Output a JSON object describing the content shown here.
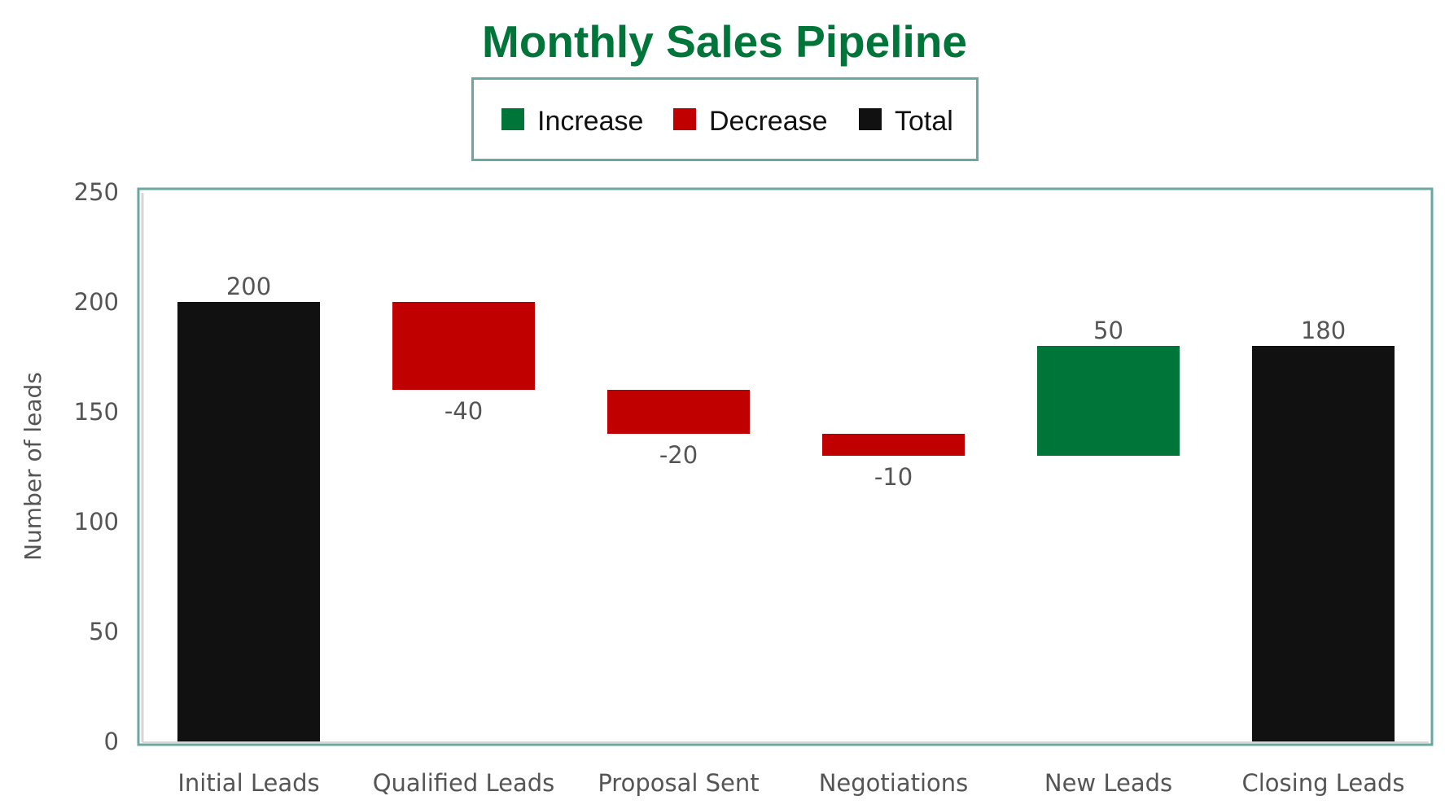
{
  "chart_data": {
    "type": "waterfall",
    "title": "Monthly Sales Pipeline",
    "xlabel": "",
    "ylabel": "Number of leads",
    "ylim": [
      0,
      250
    ],
    "yticks": [
      0,
      50,
      100,
      150,
      200,
      250
    ],
    "grid": false,
    "legend": {
      "placement": "top-center",
      "entries": [
        {
          "key": "increase",
          "label": "Increase",
          "color": "#00753A"
        },
        {
          "key": "decrease",
          "label": "Decrease",
          "color": "#C00000"
        },
        {
          "key": "total",
          "label": "Total",
          "color": "#111111"
        }
      ]
    },
    "categories": [
      "Initial Leads",
      "Qualified Leads",
      "Proposal Sent",
      "Negotiations",
      "New Leads",
      "Closing Leads"
    ],
    "values": [
      200,
      -40,
      -20,
      -10,
      50,
      180
    ],
    "kinds": [
      "total",
      "decrease",
      "decrease",
      "decrease",
      "increase",
      "total"
    ],
    "data_labels": [
      "200",
      "-40",
      "-20",
      "-10",
      "50",
      "180"
    ],
    "running_totals": [
      200,
      160,
      140,
      130,
      180,
      180
    ]
  },
  "colors": {
    "title": "#00753A",
    "frame": "#68A8A0",
    "inner_axis": "#D6D6D6",
    "text": "#555555"
  }
}
